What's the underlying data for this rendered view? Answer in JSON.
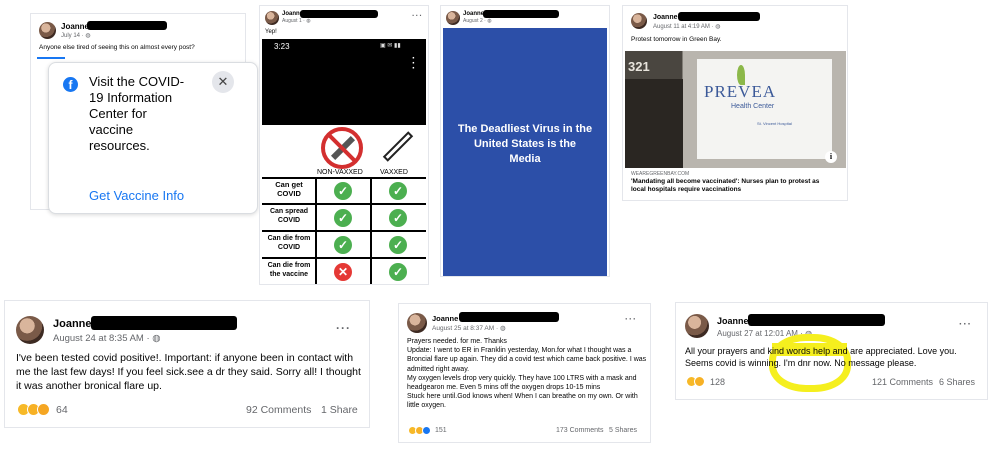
{
  "posts": {
    "p1": {
      "name": "Joanne",
      "date": "July 14 · ",
      "text": "Anyone else tired of seeing this on almost every post?",
      "card_title": "Visit the COVID-19 Information Center for vaccine resources.",
      "card_link": "Get Vaccine Info"
    },
    "p2": {
      "name": "Joanne",
      "date": "August 1 · ",
      "text": "Yep!",
      "phone_time": "3:23",
      "col_nonvax": "NON-VAXXED",
      "col_vax": "VAXXED",
      "rows": [
        {
          "label": "Can get COVID",
          "nonvax": "check",
          "vax": "check"
        },
        {
          "label": "Can spread COVID",
          "nonvax": "check",
          "vax": "check"
        },
        {
          "label": "Can die from COVID",
          "nonvax": "check",
          "vax": "check"
        },
        {
          "label": "Can die from the vaccine",
          "nonvax": "x",
          "vax": "check"
        }
      ]
    },
    "p3": {
      "name": "Joanne",
      "date": "August 2 · ",
      "image_text": "The Deadliest Virus in the United States is the Media",
      "bg_color": "#2c4fa8"
    },
    "p4": {
      "name": "Joanne",
      "date": "August 11 at 4:19 AM · ",
      "text": "Protest tomorrow in Green Bay.",
      "building_number": "321",
      "sign_text": "PREVEA",
      "sign_sub": "Health Center",
      "sign_sub2": "St. Vincent Hospital",
      "link_domain": "WEAREGREENBAY.COM",
      "link_title": "'Mandating all become vaccinated': Nurses plan to protest as local hospitals require vaccinations"
    },
    "p5": {
      "name": "Joanne",
      "date": "August 24 at 8:35 AM · ",
      "text": "I've been tested covid positive!. Important: if anyone been in contact with me the last few days! If you feel sick.see a dr they said. Sorry all! I thought it was another bronical flare up.",
      "reactions": "64",
      "comments": "92 Comments",
      "shares": "1 Share"
    },
    "p6": {
      "name": "Joanne",
      "date": "August 25 at 8:37 AM · ",
      "lines": [
        "Prayers needed. for me. Thanks",
        "Update: I went to ER in Franklin yesterday, Mon.for what I thought was a Broncial flare up again. They did a covid test which came back positive. I was admitted right away.",
        "My oxygen levels drop very quickly. They have 100 LTRS with a mask and headgearon me. Even 5 mins off the oxygen drops 10-15 mins",
        "Stuck here until.God knows when! When I can breathe on my own. Or with little oxygen."
      ],
      "reactions": "151",
      "comments": "173 Comments",
      "shares": "5 Shares"
    },
    "p7": {
      "name": "Joanne",
      "date": "August 27 at 12:01 AM · ",
      "text": "All your prayers and kind words help and are appreciated. Love you. Seems covid is winning. I'm dnr now. No message please.",
      "reactions": "128",
      "comments": "121 Comments",
      "shares": "6 Shares",
      "highlight_color": "#f5ef1e"
    }
  },
  "icons": [
    "globe-icon",
    "facebook-icon",
    "close-icon",
    "more-icon",
    "syringe-icon",
    "info-icon"
  ]
}
